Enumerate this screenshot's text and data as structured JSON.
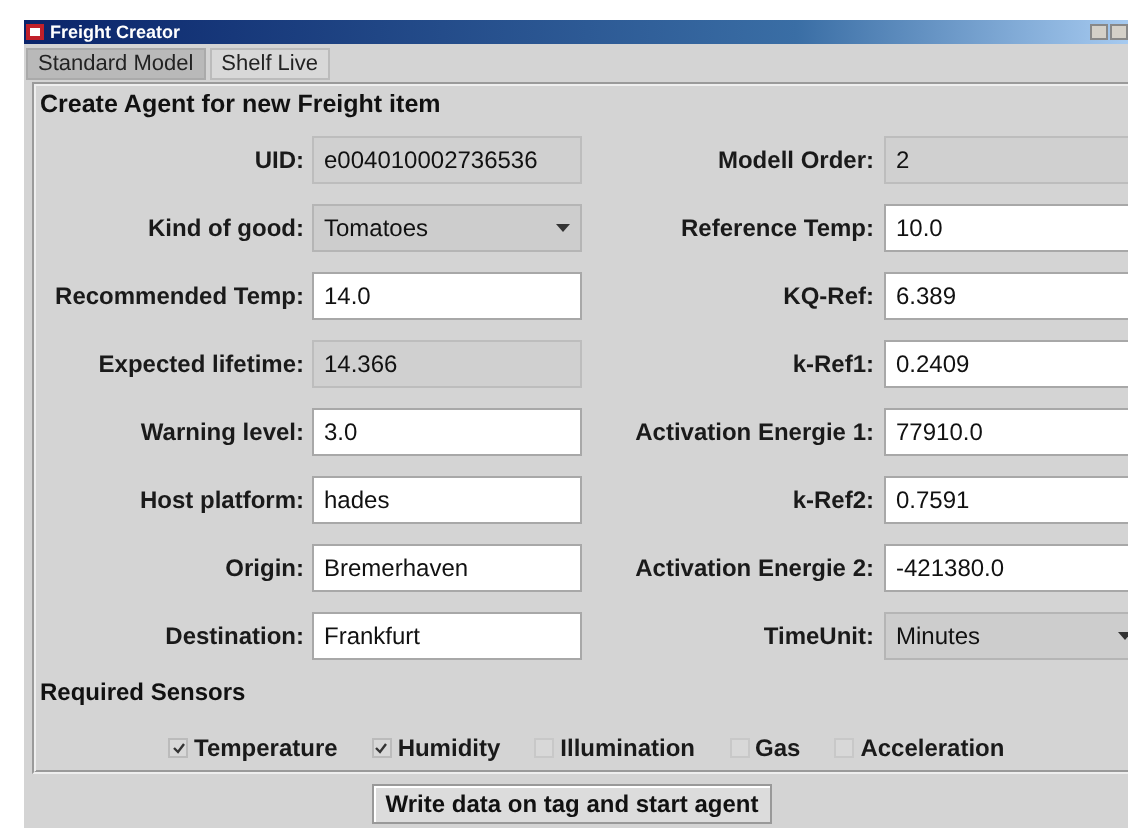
{
  "window": {
    "title": "Freight Creator"
  },
  "tabs": [
    {
      "label": "Standard Model",
      "selected": true
    },
    {
      "label": "Shelf Live",
      "selected": false
    }
  ],
  "group": {
    "title": "Create Agent for new Freight item"
  },
  "left_fields": [
    {
      "label": "UID:",
      "value": "e004010002736536",
      "kind": "readonly"
    },
    {
      "label": "Kind of good:",
      "value": "Tomatoes",
      "kind": "combo"
    },
    {
      "label": "Recommended Temp:",
      "value": "14.0",
      "kind": "text"
    },
    {
      "label": "Expected lifetime:",
      "value": "14.366",
      "kind": "readonly"
    },
    {
      "label": "Warning level:",
      "value": "3.0",
      "kind": "text"
    },
    {
      "label": "Host platform:",
      "value": "hades",
      "kind": "text"
    },
    {
      "label": "Origin:",
      "value": "Bremerhaven",
      "kind": "text"
    },
    {
      "label": "Destination:",
      "value": "Frankfurt",
      "kind": "text"
    }
  ],
  "right_fields": [
    {
      "label": "Modell Order:",
      "value": "2",
      "kind": "readonly"
    },
    {
      "label": "Reference Temp:",
      "value": "10.0",
      "kind": "text"
    },
    {
      "label": "KQ-Ref:",
      "value": "6.389",
      "kind": "text"
    },
    {
      "label": "k-Ref1:",
      "value": "0.2409",
      "kind": "text"
    },
    {
      "label": "Activation Energie 1:",
      "value": "77910.0",
      "kind": "text"
    },
    {
      "label": "k-Ref2:",
      "value": "0.7591",
      "kind": "text"
    },
    {
      "label": "Activation Energie 2:",
      "value": "-421380.0",
      "kind": "text"
    },
    {
      "label": "TimeUnit:",
      "value": "Minutes",
      "kind": "combo"
    }
  ],
  "sensors": {
    "title": "Required Sensors",
    "items": [
      {
        "label": "Temperature",
        "checked": true
      },
      {
        "label": "Humidity",
        "checked": true
      },
      {
        "label": "Illumination",
        "checked": false
      },
      {
        "label": "Gas",
        "checked": false
      },
      {
        "label": "Acceleration",
        "checked": false
      }
    ]
  },
  "button": "Write data on tag and start agent"
}
